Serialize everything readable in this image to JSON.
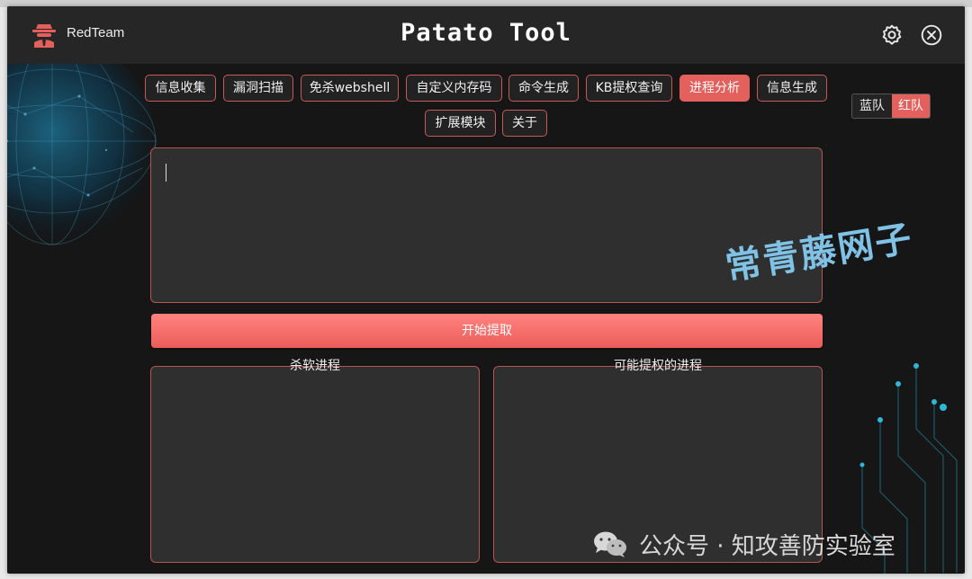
{
  "app": {
    "brand": "RedTeam",
    "title": "Patato Tool"
  },
  "tabs": [
    {
      "label": "信息收集",
      "active": false
    },
    {
      "label": "漏洞扫描",
      "active": false
    },
    {
      "label": "免杀webshell",
      "active": false
    },
    {
      "label": "自定义内存码",
      "active": false
    },
    {
      "label": "命令生成",
      "active": false
    },
    {
      "label": "KB提权查询",
      "active": false
    },
    {
      "label": "进程分析",
      "active": true
    },
    {
      "label": "信息生成",
      "active": false
    },
    {
      "label": "扩展模块",
      "active": false
    },
    {
      "label": "关于",
      "active": false
    }
  ],
  "team_toggle": {
    "blue_label": "蓝队",
    "red_label": "红队",
    "selected": "红队"
  },
  "input": {
    "value": ""
  },
  "actions": {
    "extract_label": "开始提取"
  },
  "panels": {
    "antivirus_label": "杀软进程",
    "escalation_label": "可能提权的进程"
  },
  "overlays": {
    "watermark": "常青藤网子",
    "wechat_label": "公众号 · 知攻善防实验室"
  },
  "icons": {
    "logo": "spy-icon",
    "settings": "gear-icon",
    "close": "close-circle-icon"
  },
  "colors": {
    "accent": "#e4605c",
    "background": "#161616",
    "titlebar": "#262626",
    "panel": "#2f2f2f",
    "watermark": "#7fc2e6"
  }
}
